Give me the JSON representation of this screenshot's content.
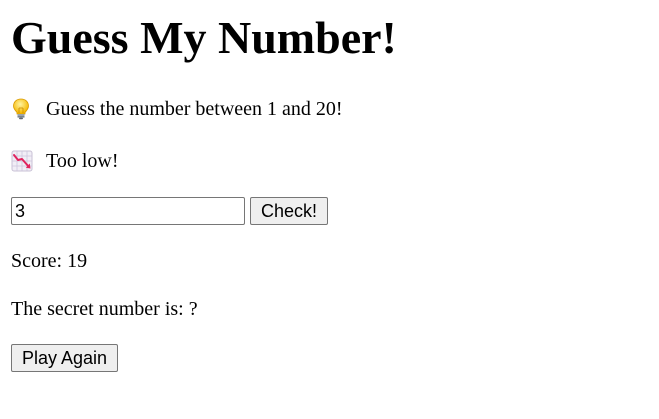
{
  "title": "Guess My Number!",
  "prompt": {
    "icon": "light-bulb-icon",
    "text": "Guess the number between 1 and 20!"
  },
  "feedback": {
    "icon": "chart-decreasing-icon",
    "text": "Too low!"
  },
  "guess_input": {
    "value": "3"
  },
  "check_button": {
    "label": "Check!"
  },
  "score": {
    "text": "Score: 19"
  },
  "secret": {
    "text": "The secret number is: ?"
  },
  "play_again_button": {
    "label": "Play Again"
  }
}
